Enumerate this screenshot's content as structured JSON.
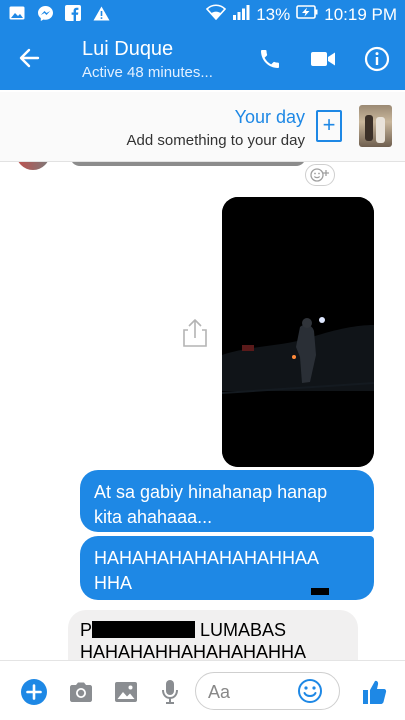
{
  "status_bar": {
    "battery": "13%",
    "time": "10:19 PM",
    "icons": [
      "gallery-icon",
      "messenger-icon",
      "facebook-icon",
      "warning-icon",
      "wifi-icon",
      "signal-icon",
      "battery-charging-icon"
    ]
  },
  "header": {
    "contact_name": "Lui Duque",
    "status": "Active 48 minutes...",
    "icons": [
      "back-arrow-icon",
      "phone-icon",
      "video-camera-icon",
      "info-icon"
    ]
  },
  "your_day": {
    "title": "Your day",
    "subtitle": "Add something to your day"
  },
  "messages": {
    "sent_1": "At sa gabiy hinahanap hanap kita ahahaaa...",
    "sent_2": "HAHAHAHAHAHAHAHHAA HHA",
    "received_1_prefix": "P",
    "received_1_suffix": "LUMABAS",
    "received_1_line2": "HAHAHAHHAHAHAHAHHA"
  },
  "composer": {
    "placeholder": "Aa",
    "icons": [
      "plus-icon",
      "camera-icon",
      "gallery-icon",
      "microphone-icon",
      "emoji-icon",
      "thumbs-up-icon"
    ]
  },
  "colors": {
    "brand": "#1e88e5",
    "incoming_bubble": "#f1f0f0"
  }
}
